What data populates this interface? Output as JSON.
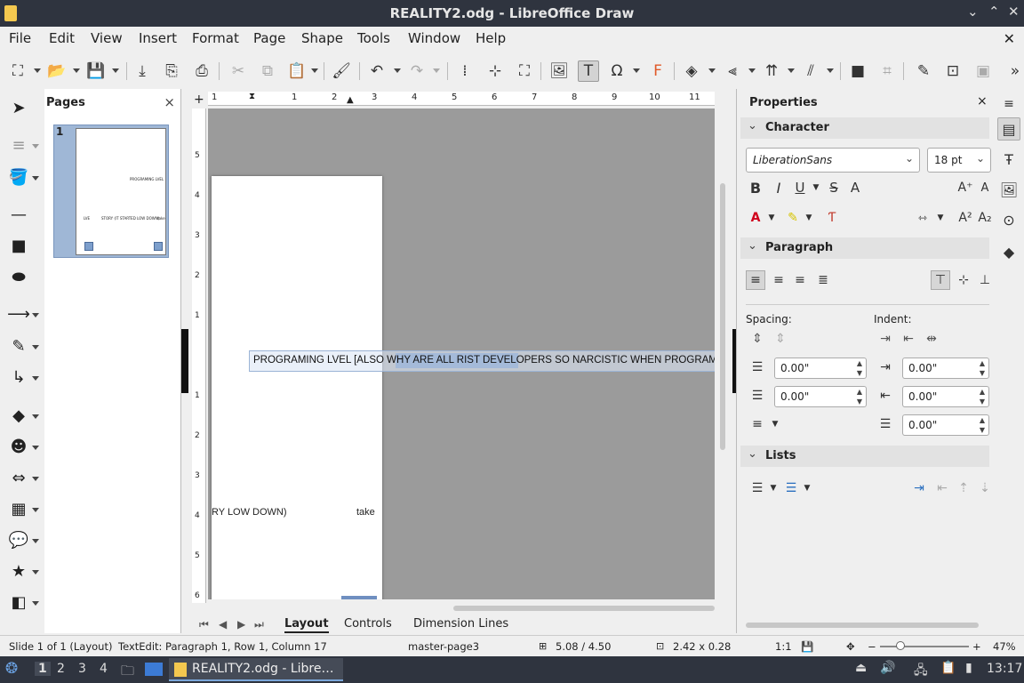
{
  "window": {
    "title": "REALITY2.odg - LibreOffice Draw",
    "controls": [
      "⌄",
      "⌃",
      "✕"
    ]
  },
  "menu": {
    "items": [
      "File",
      "Edit",
      "View",
      "Insert",
      "Format",
      "Page",
      "Shape",
      "Tools",
      "Window",
      "Help"
    ],
    "close": "✕"
  },
  "pages_panel": {
    "title": "Pages",
    "close": "×",
    "thumb_number": "1",
    "thumb_text_top": "PROGRAMING LVEL",
    "thumb_text_mid": "STORY (IT STARTED LOW DOWN)",
    "thumb_text_left": "LVE",
    "thumb_text_right": "take"
  },
  "ruler": {
    "h_labels": [
      "1",
      "1",
      "2",
      "3",
      "4",
      "5",
      "6",
      "7",
      "8",
      "9",
      "10",
      "11"
    ],
    "v_labels": [
      "5",
      "4",
      "3",
      "2",
      "1",
      "1",
      "2",
      "3",
      "4",
      "5",
      "6"
    ]
  },
  "canvas": {
    "text_line": "PROGRAMING LVEL [ALSO WHY ARE ALL RIST DEVELOPERS SO NARCISTIC WHEN PROGRAM",
    "fragment_left": "RY LOW DOWN)",
    "fragment_right": "take"
  },
  "tabs": {
    "layout": "Layout",
    "controls": "Controls",
    "dimension": "Dimension Lines"
  },
  "sidebar": {
    "title": "Properties",
    "close": "×",
    "character_label": "Character",
    "font_name": "LiberationSans",
    "font_size": "18 pt",
    "paragraph_label": "Paragraph",
    "spacing_label": "Spacing:",
    "indent_label": "Indent:",
    "spacing_above": "0.00\"",
    "spacing_below": "0.00\"",
    "indent_before": "0.00\"",
    "indent_after": "0.00\"",
    "indent_first": "0.00\"",
    "lists_label": "Lists"
  },
  "status": {
    "slide": "Slide 1 of 1 (Layout)",
    "edit": "TextEdit: Paragraph 1, Row 1, Column 17",
    "master": "master-page3",
    "position": "5.08 / 4.50",
    "size": "2.42 x 0.28",
    "scale": "1:1",
    "zoom": "47%"
  },
  "taskbar": {
    "workspaces": [
      "1",
      "2",
      "3",
      "4"
    ],
    "task_title": "REALITY2.odg - Libre…",
    "clock": "13:17"
  }
}
